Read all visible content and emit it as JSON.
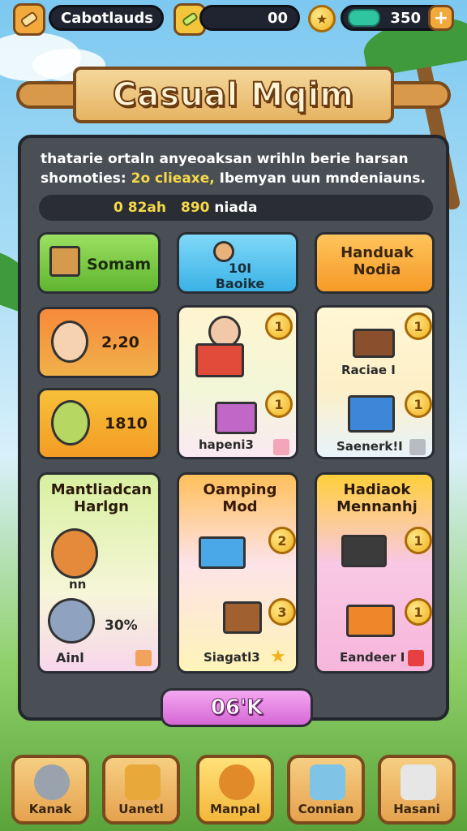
{
  "topbar": {
    "player_name": "Cabotlauds",
    "energy_value": "00",
    "gems_value": "350",
    "add_label": "+"
  },
  "title": "Casual Mqim",
  "panel": {
    "desc_line1": "thatarie ortaln anyeoaksan wrihln berie harsan",
    "desc_line2a": "shomoties:",
    "desc_line2b": "2o clieaxe,",
    "desc_line2c": "Ibemyan uun mndeniauns.",
    "stat_a": "0 82ah",
    "stat_b": "890",
    "stat_c": "niada"
  },
  "tabs": [
    {
      "label": "Somam"
    },
    {
      "label": "10I Baoike"
    },
    {
      "label": "Handuak Nodia"
    }
  ],
  "cards": {
    "char1_value": "2,20",
    "char2_value": "1810",
    "gift_box_coin": "1",
    "gift_box2_label": "hapeni3",
    "gift_box2_coin": "1",
    "cake_label": "Raciae I",
    "cake_coin": "1",
    "blue_gift_label": "Saenerk!I",
    "blue_gift_coin": "1",
    "mantl_title": "Mantliadcan Harlgn",
    "mantl_sub": "nn",
    "mantl_pct": "30%",
    "mantl_bottom": "Ainl",
    "camping_title": "Oamping Mod",
    "camping_label": "Siagatl3",
    "camping_coin1": "2",
    "camping_coin2": "3",
    "hadiak_title": "Hadiaok Mennanhj",
    "hadiak_label": "Eandeer I",
    "hadiak_coin1": "1",
    "hadiak_coin2": "1"
  },
  "ok_button": "06'K",
  "nav": [
    {
      "label": "Kanak"
    },
    {
      "label": "Uanetl"
    },
    {
      "label": "Manpal"
    },
    {
      "label": "Connian"
    },
    {
      "label": "Hasani"
    }
  ],
  "colors": {
    "green_tab": "#7bd04a",
    "blue_tab": "#5bc8f0",
    "orange_tab": "#f7a53a",
    "accent_yellow": "#f6d94a",
    "panel": "#4a4e55"
  }
}
